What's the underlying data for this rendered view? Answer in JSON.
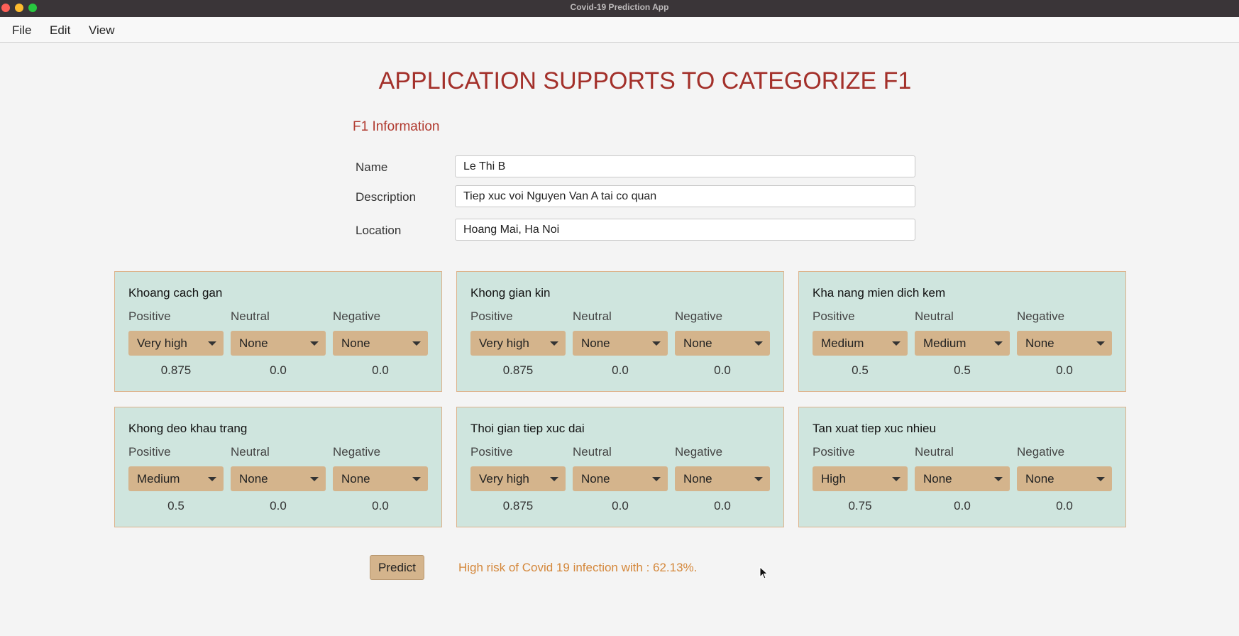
{
  "window": {
    "title": "Covid-19 Prediction App"
  },
  "menu": {
    "items": [
      "File",
      "Edit",
      "View"
    ]
  },
  "app_title": "APPLICATION SUPPORTS TO CATEGORIZE F1",
  "section_title": "F1 Information",
  "fields": {
    "name": {
      "label": "Name",
      "value": "Le Thi B"
    },
    "description": {
      "label": "Description",
      "value": "Tiep xuc voi Nguyen Van A tai co quan"
    },
    "location": {
      "label": "Location",
      "value": "Hoang Mai, Ha Noi"
    }
  },
  "column_headers": [
    "Positive",
    "Neutral",
    "Negative"
  ],
  "panels": [
    {
      "title": "Khoang cach gan",
      "selects": [
        "Very high",
        "None",
        "None"
      ],
      "scores": [
        "0.875",
        "0.0",
        "0.0"
      ]
    },
    {
      "title": "Khong gian kin",
      "selects": [
        "Very high",
        "None",
        "None"
      ],
      "scores": [
        "0.875",
        "0.0",
        "0.0"
      ]
    },
    {
      "title": "Kha nang mien dich kem",
      "selects": [
        "Medium",
        "Medium",
        "None"
      ],
      "scores": [
        "0.5",
        "0.5",
        "0.0"
      ]
    },
    {
      "title": "Khong deo khau trang",
      "selects": [
        "Medium",
        "None",
        "None"
      ],
      "scores": [
        "0.5",
        "0.0",
        "0.0"
      ]
    },
    {
      "title": "Thoi gian tiep xuc dai",
      "selects": [
        "Very high",
        "None",
        "None"
      ],
      "scores": [
        "0.875",
        "0.0",
        "0.0"
      ]
    },
    {
      "title": "Tan xuat tiep xuc nhieu",
      "selects": [
        "High",
        "None",
        "None"
      ],
      "scores": [
        "0.75",
        "0.0",
        "0.0"
      ]
    }
  ],
  "predict_label": "Predict",
  "result_text": "High risk of Covid 19 infection with : 62.13%.",
  "colors": {
    "title": "#a3302a",
    "panel_bg": "#cfe5de",
    "dropdown_bg": "#d4b48c",
    "result": "#d4873a"
  }
}
